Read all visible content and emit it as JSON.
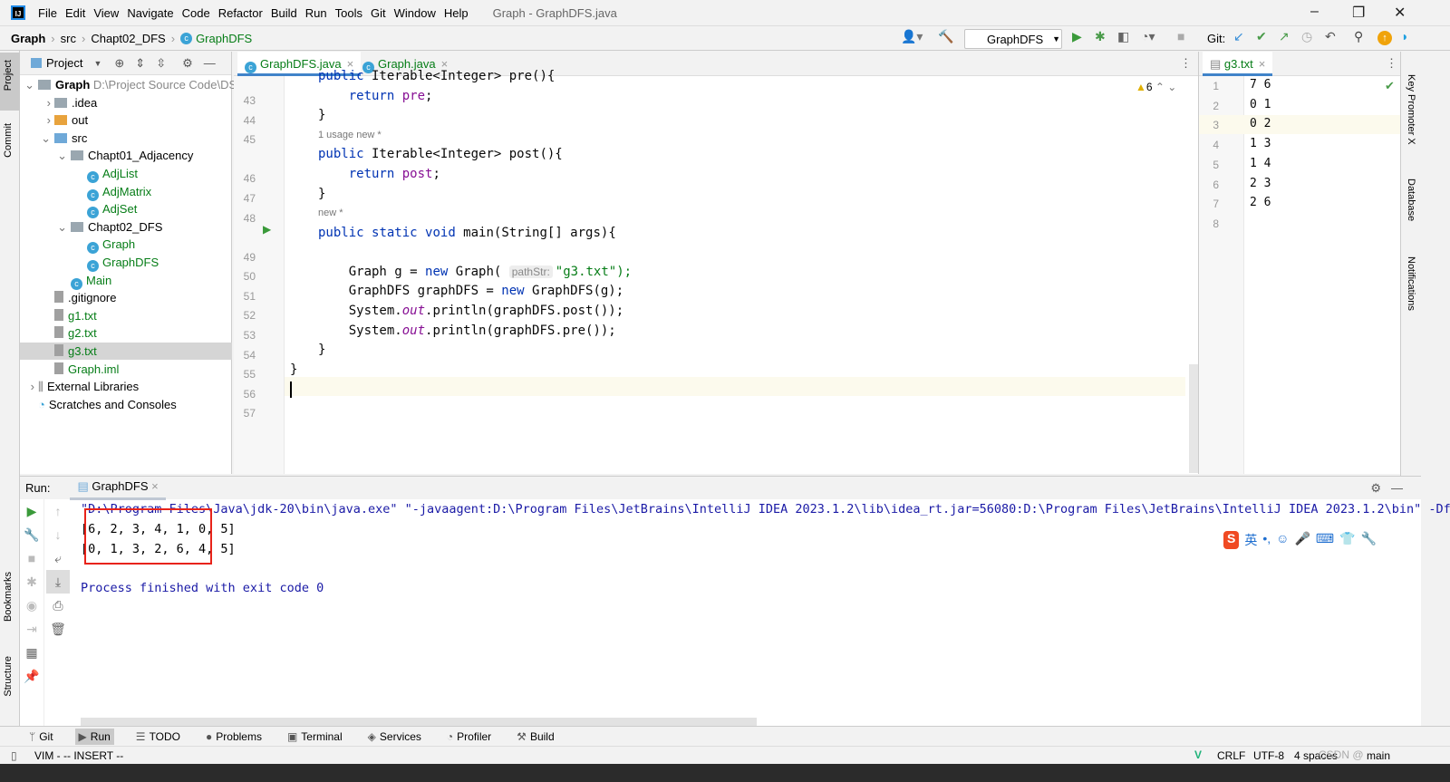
{
  "menu": {
    "items": [
      "File",
      "Edit",
      "View",
      "Navigate",
      "Code",
      "Refactor",
      "Build",
      "Run",
      "Tools",
      "Git",
      "Window",
      "Help"
    ],
    "window_title": "Graph - GraphDFS.java"
  },
  "breadcrumb": [
    "Graph",
    "src",
    "Chapt02_DFS",
    "GraphDFS"
  ],
  "toolbar": {
    "run_config": "GraphDFS",
    "git_label": "Git:"
  },
  "left_strip": [
    "Project",
    "Commit",
    "Bookmarks",
    "Structure"
  ],
  "right_strip": [
    "Key Promoter X",
    "Database",
    "Notifications"
  ],
  "project": {
    "title": "Project",
    "tree": [
      {
        "label": "Graph",
        "path": "D:\\Project Source Code\\DS",
        "type": "module"
      },
      {
        "label": ".idea",
        "type": "folder"
      },
      {
        "label": "out",
        "type": "folder-excluded"
      },
      {
        "label": "src",
        "type": "folder-source"
      },
      {
        "label": "Chapt01_Adjacency",
        "type": "package"
      },
      {
        "label": "AdjList",
        "type": "class"
      },
      {
        "label": "AdjMatrix",
        "type": "class"
      },
      {
        "label": "AdjSet",
        "type": "class"
      },
      {
        "label": "Chapt02_DFS",
        "type": "package"
      },
      {
        "label": "Graph",
        "type": "class"
      },
      {
        "label": "GraphDFS",
        "type": "class"
      },
      {
        "label": "Main",
        "type": "class"
      },
      {
        "label": ".gitignore",
        "type": "file"
      },
      {
        "label": "g1.txt",
        "type": "file"
      },
      {
        "label": "g2.txt",
        "type": "file"
      },
      {
        "label": "g3.txt",
        "type": "file",
        "selected": true
      },
      {
        "label": "Graph.iml",
        "type": "file"
      },
      {
        "label": "External Libraries",
        "type": "lib"
      },
      {
        "label": "Scratches and Consoles",
        "type": "scratch"
      }
    ]
  },
  "editor": {
    "tabs": [
      "GraphDFS.java",
      "Graph.java"
    ],
    "warnings": "6",
    "lines": [
      {
        "n": "43",
        "html": "public Iterable<Integer> pre(){"
      },
      {
        "n": "44",
        "html": "    return pre;"
      },
      {
        "n": "45",
        "html": "}"
      },
      {
        "meta": "1 usage   new *"
      },
      {
        "n": "46",
        "html": "public Iterable<Integer> post(){"
      },
      {
        "n": "47",
        "html": "    return post;"
      },
      {
        "n": "48",
        "html": "}"
      },
      {
        "meta": "new *"
      },
      {
        "n": "49",
        "html": "public static void main(String[] args){"
      },
      {
        "n": "50",
        "html": ""
      },
      {
        "n": "51",
        "html": "    Graph g = new Graph( ",
        "hint": "pathStr:",
        "after": "\"g3.txt\");"
      },
      {
        "n": "52",
        "html": "    GraphDFS graphDFS = new GraphDFS(g);"
      },
      {
        "n": "53",
        "html": "    System.out.println(graphDFS.post());"
      },
      {
        "n": "54",
        "html": "    System.out.println(graphDFS.pre());"
      },
      {
        "n": "55",
        "html": "}"
      },
      {
        "n": "56",
        "html": "}"
      },
      {
        "n": "57",
        "html": ""
      }
    ]
  },
  "g3": {
    "tab": "g3.txt",
    "lines": [
      "7 6",
      "0 1",
      "0 2",
      "1 3",
      "1 4",
      "2 3",
      "2 6",
      ""
    ]
  },
  "run": {
    "label": "Run:",
    "tab": "GraphDFS",
    "command": "\"D:\\Program Files\\Java\\jdk-20\\bin\\java.exe\" \"-javaagent:D:\\Program Files\\JetBrains\\IntelliJ IDEA 2023.1.2\\lib\\idea_rt.jar=56080:D:\\Program Files\\JetBrains\\IntelliJ IDEA 2023.1.2\\bin\" -Df",
    "output": [
      "[6, 2, 3, 4, 1, 0, 5]",
      "[0, 1, 3, 2, 6, 4, 5]",
      "",
      "Process finished with exit code 0"
    ],
    "highlight_color": "#e8231a"
  },
  "ime": "英",
  "bottom_tabs": [
    "Git",
    "Run",
    "TODO",
    "Problems",
    "Terminal",
    "Services",
    "Profiler",
    "Build"
  ],
  "status": {
    "mode": "VIM - -- INSERT --",
    "line_sep": "CRLF",
    "encoding": "UTF-8",
    "indent": "4 spaces",
    "branch": "main",
    "watermark": "CSDN @"
  }
}
